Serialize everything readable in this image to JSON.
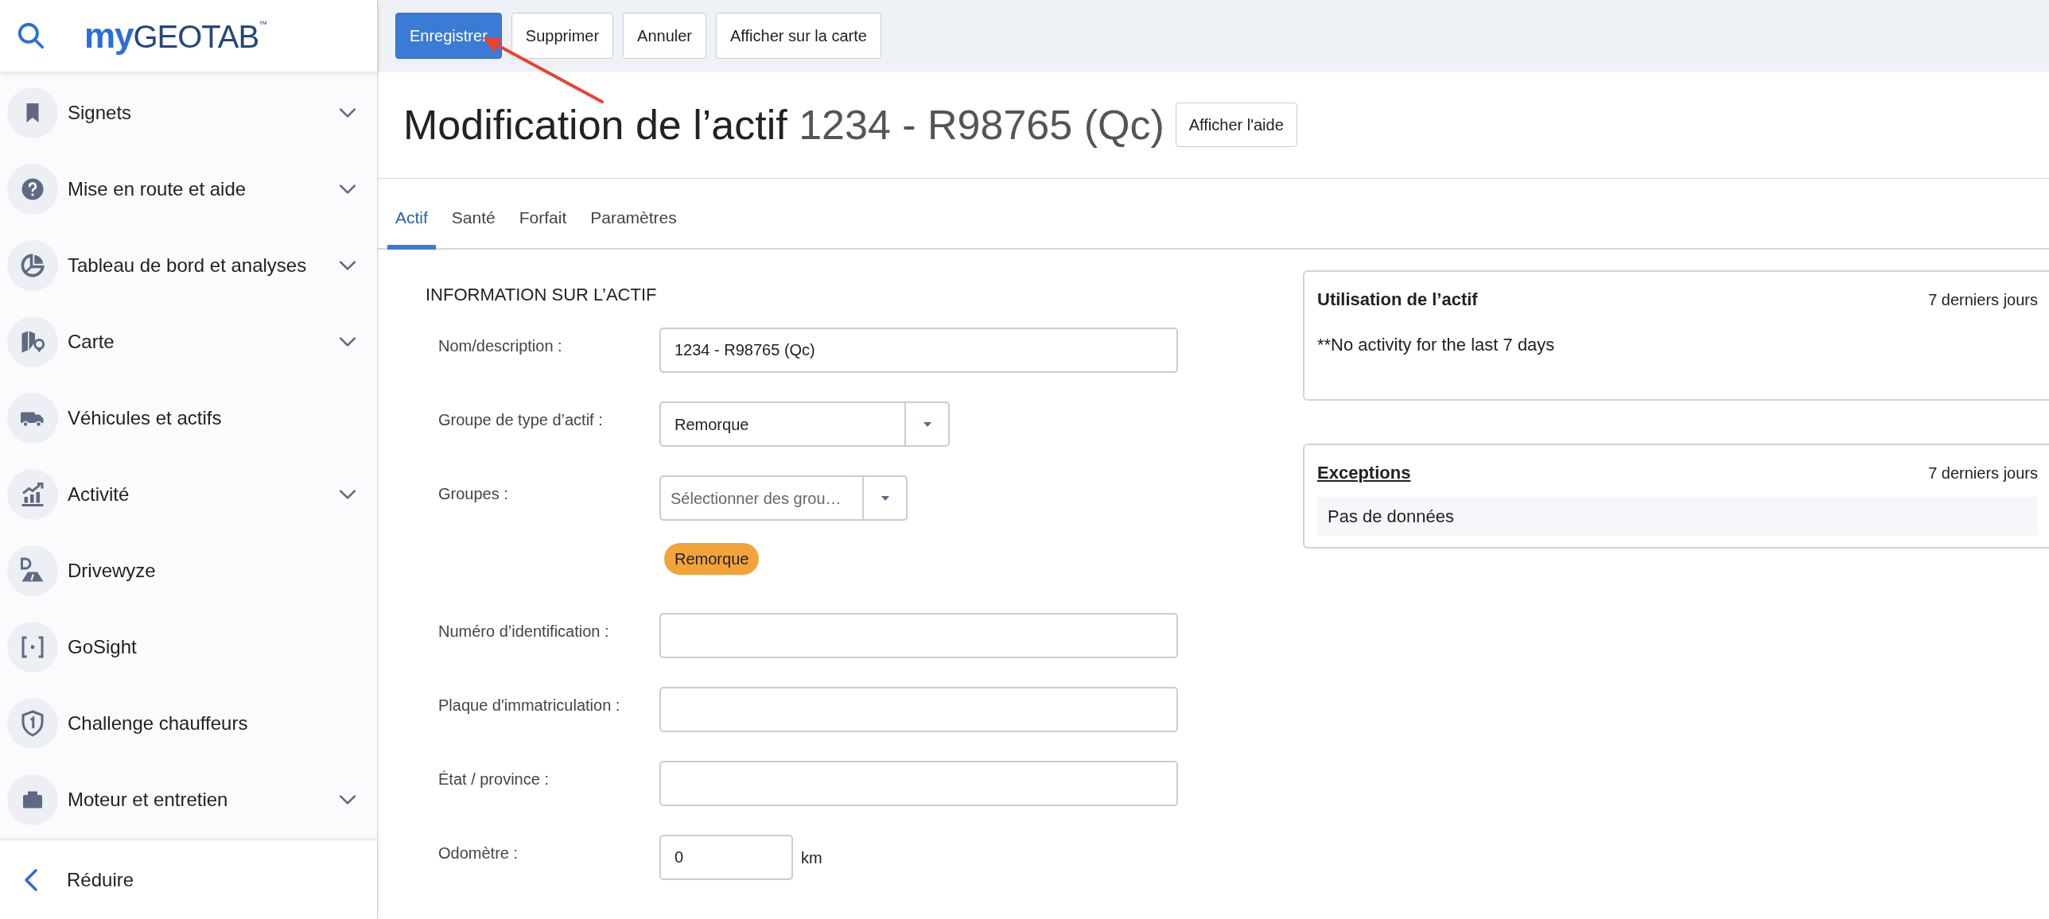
{
  "sidebar": {
    "logo": {
      "prefix": "my",
      "name": "GEOTAB",
      "mark": "™"
    },
    "items": [
      {
        "label": "Signets",
        "expandable": true
      },
      {
        "label": "Mise en route et aide",
        "expandable": true
      },
      {
        "label": "Tableau de bord et analyses",
        "expandable": true
      },
      {
        "label": "Carte",
        "expandable": true
      },
      {
        "label": "Véhicules et actifs",
        "expandable": false
      },
      {
        "label": "Activité",
        "expandable": true
      },
      {
        "label": "Drivewyze",
        "expandable": false
      },
      {
        "label": "GoSight",
        "expandable": false
      },
      {
        "label": "Challenge chauffeurs",
        "expandable": false
      },
      {
        "label": "Moteur et entretien",
        "expandable": true
      }
    ],
    "collapse": "Réduire"
  },
  "toolbar": {
    "buttons": [
      {
        "label": "Enregistrer",
        "kind": "primary"
      },
      {
        "label": "Supprimer",
        "kind": "default"
      },
      {
        "label": "Annuler",
        "kind": "default"
      },
      {
        "label": "Afficher sur la carte",
        "kind": "default"
      }
    ]
  },
  "header": {
    "title": "Modification de l’actif",
    "asset": "1234 - R98765 (Qc)",
    "help_button": "Afficher l'aide"
  },
  "tabs": [
    {
      "label": "Actif",
      "selected": true
    },
    {
      "label": "Santé",
      "selected": false
    },
    {
      "label": "Forfait",
      "selected": false
    },
    {
      "label": "Paramètres",
      "selected": false
    }
  ],
  "form": {
    "heading": "INFORMATION SUR L’ACTIF",
    "fields": [
      {
        "kind": "text",
        "label": "Nom/description :",
        "value": "1234 - R98765 (Qc)"
      },
      {
        "kind": "select",
        "label": "Groupe de type d’actif :",
        "value": "Remorque"
      },
      {
        "kind": "multiselect",
        "label": "Groupes :",
        "placeholder": "Sélectionner des grou…",
        "tags": [
          {
            "label": "Remorque",
            "color": "#f2a33a"
          }
        ]
      },
      {
        "kind": "text",
        "label": "Numéro d’identification :"
      },
      {
        "kind": "text",
        "label": "Plaque d'immatriculation :"
      },
      {
        "kind": "text",
        "label": "État / province :"
      },
      {
        "kind": "number",
        "label": "Odomètre :",
        "value": "0",
        "unit": "km"
      }
    ]
  },
  "panels": [
    {
      "kind": "note",
      "title": "Utilisation de l’actif",
      "period": "7 derniers jours",
      "body": "**No activity for the last 7 days"
    },
    {
      "kind": "list",
      "title": "Exceptions",
      "period": "7 derniers jours",
      "body": "Pas de données"
    }
  ]
}
